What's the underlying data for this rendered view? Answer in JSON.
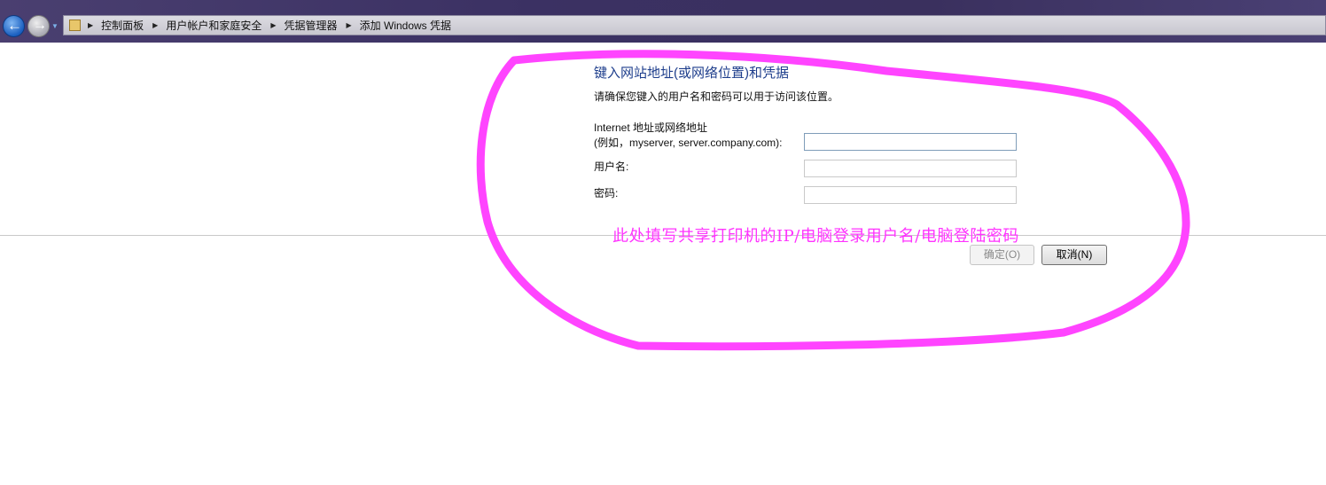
{
  "breadcrumb": [
    "控制面板",
    "用户帐户和家庭安全",
    "凭据管理器",
    "添加 Windows 凭据"
  ],
  "dialog": {
    "title": "键入网站地址(或网络位置)和凭据",
    "subtitle": "请确保您键入的用户名和密码可以用于访问该位置。",
    "address_label_1": "Internet 地址或网络地址",
    "address_label_2": "(例如，myserver, server.company.com):",
    "username_label": "用户名:",
    "password_label": "密码:",
    "address_value": "",
    "username_value": "",
    "password_value": "",
    "ok_label": "确定(O)",
    "cancel_label": "取消(N)"
  },
  "annotation": {
    "text": "此处填写共享打印机的IP/电脑登录用户名/电脑登陆密码",
    "color": "#ff33ff"
  }
}
